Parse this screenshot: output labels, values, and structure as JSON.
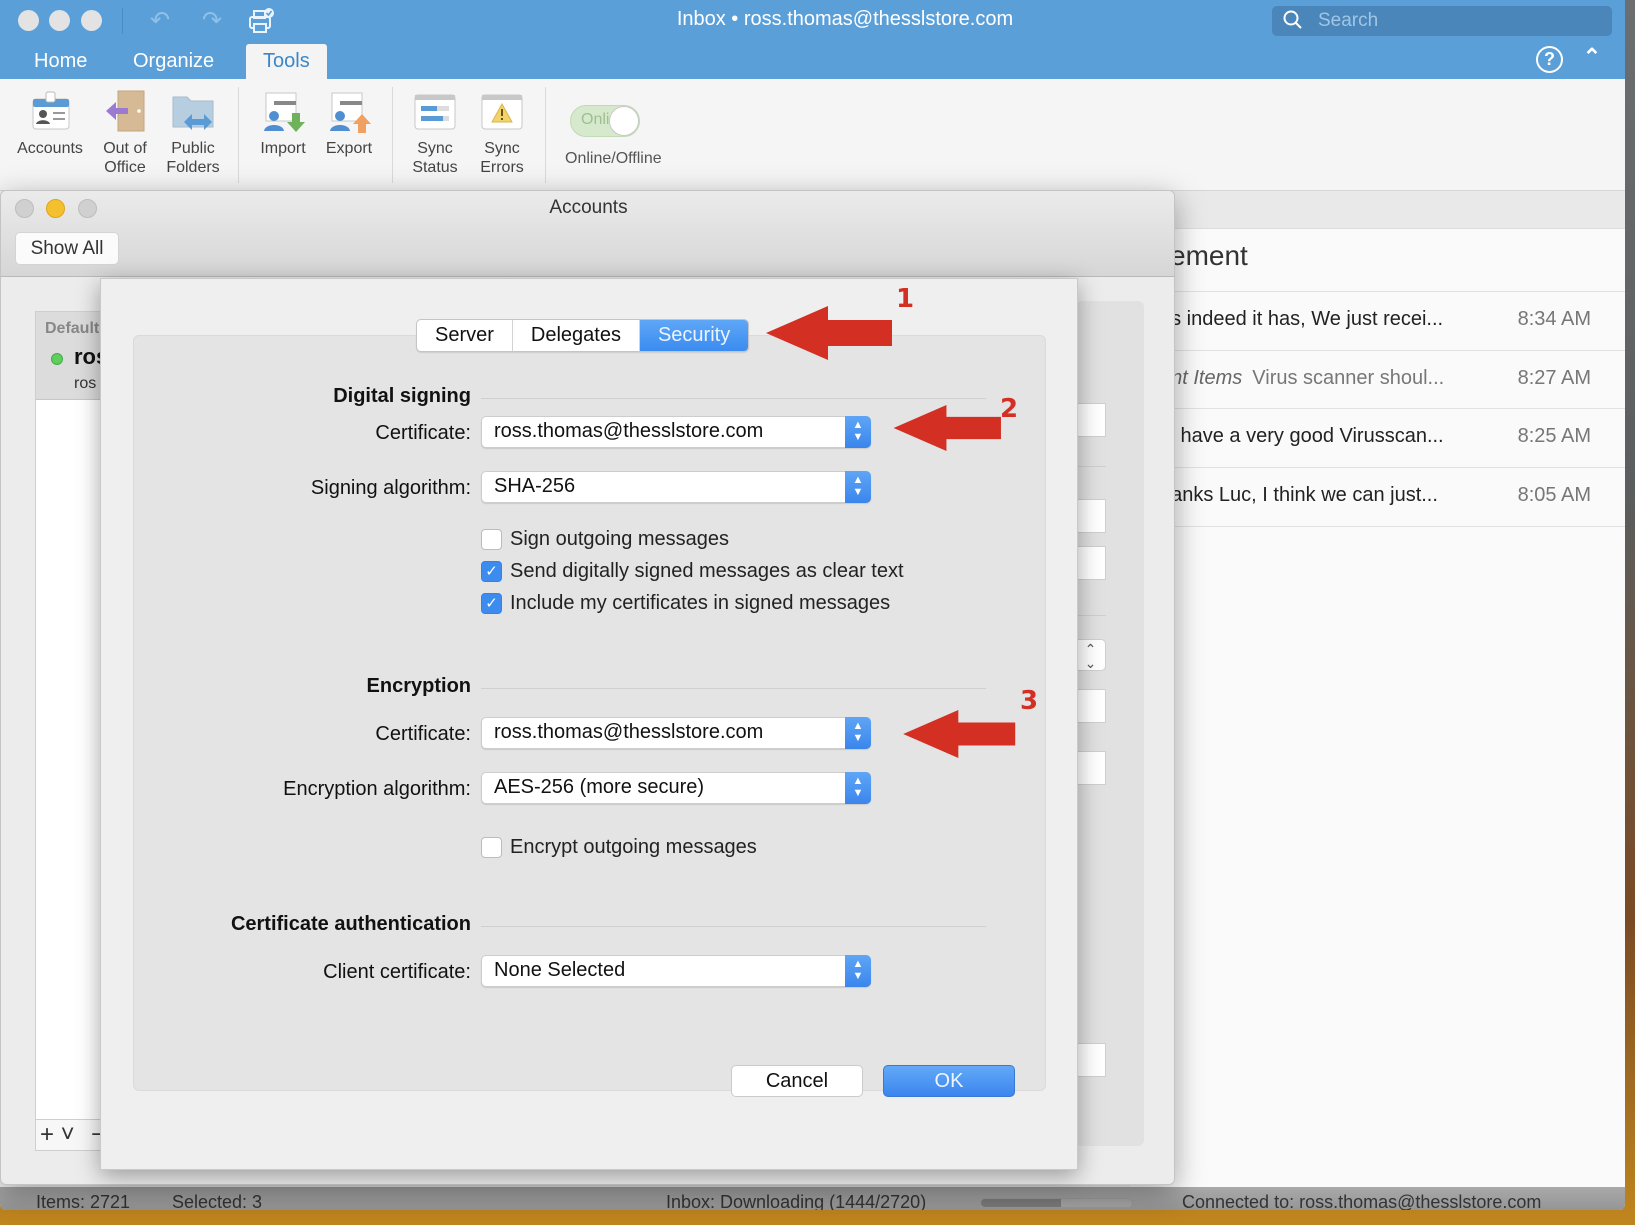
{
  "window": {
    "title": "Inbox • ross.thomas@thesslstore.com",
    "search_placeholder": "Search"
  },
  "quick_access": {
    "icons": [
      "undo-icon",
      "redo-icon",
      "print-icon"
    ]
  },
  "ribbon_tabs": [
    {
      "label": "Home",
      "active": false
    },
    {
      "label": "Organize",
      "active": false
    },
    {
      "label": "Tools",
      "active": true
    }
  ],
  "ribbon": {
    "buttons": [
      {
        "label": "Accounts",
        "icon": "accounts-card-icon"
      },
      {
        "label": "Out of Office",
        "line1": "Out of",
        "line2": "Office",
        "icon": "out-of-office-door-icon"
      },
      {
        "label": "Public Folders",
        "line1": "Public",
        "line2": "Folders",
        "icon": "public-folders-icon"
      },
      {
        "label": "Import",
        "icon": "import-icon"
      },
      {
        "label": "Export",
        "icon": "export-icon"
      },
      {
        "label": "Sync Status",
        "line1": "Sync",
        "line2": "Status",
        "icon": "sync-status-icon"
      },
      {
        "label": "Sync Errors",
        "line1": "Sync",
        "line2": "Errors",
        "icon": "sync-errors-icon"
      }
    ],
    "online_toggle": {
      "label": "Online",
      "caption": "Online/Offline",
      "on": true
    }
  },
  "message_list": {
    "title_fragment": "ement",
    "messages": [
      {
        "folder": "",
        "preview": "es indeed it has, We just recei...",
        "time": "8:34 AM",
        "muted": false
      },
      {
        "folder": "ent Items",
        "preview": "Virus scanner shoul...",
        "time": "8:27 AM",
        "muted": true
      },
      {
        "folder": "",
        "preview": "'e have a very good Virusscan...",
        "time": "8:25 AM",
        "muted": false
      },
      {
        "folder": "",
        "preview": "hanks Luc, I think we can just...",
        "time": "8:05 AM",
        "muted": false
      }
    ]
  },
  "status_bar": {
    "items": "Items: 2721",
    "selected": "Selected: 3",
    "download_status": "Inbox: Downloading (1444/2720)",
    "download_progress": 0.53,
    "connected": "Connected to: ross.thomas@thesslstore.com"
  },
  "accounts_window": {
    "title": "Accounts",
    "show_all": "Show All",
    "list": {
      "default_label": "Default",
      "account_name": "ros",
      "account_email": "ros"
    },
    "add_label": "+ ˅",
    "remove_label": "−"
  },
  "security_sheet": {
    "tabs": [
      {
        "label": "Server",
        "active": false
      },
      {
        "label": "Delegates",
        "active": false
      },
      {
        "label": "Security",
        "active": true
      }
    ],
    "digital_signing": {
      "heading": "Digital signing",
      "certificate_label": "Certificate:",
      "certificate_value": "ross.thomas@thesslstore.com",
      "algorithm_label": "Signing algorithm:",
      "algorithm_value": "SHA-256",
      "checkboxes": [
        {
          "label": "Sign outgoing messages",
          "checked": false
        },
        {
          "label": "Send digitally signed messages as clear text",
          "checked": true
        },
        {
          "label": "Include my certificates in signed messages",
          "checked": true
        }
      ]
    },
    "encryption": {
      "heading": "Encryption",
      "certificate_label": "Certificate:",
      "certificate_value": "ross.thomas@thesslstore.com",
      "algorithm_label": "Encryption algorithm:",
      "algorithm_value": "AES-256 (more secure)",
      "checkboxes": [
        {
          "label": "Encrypt outgoing messages",
          "checked": false
        }
      ]
    },
    "cert_auth": {
      "heading": "Certificate authentication",
      "client_label": "Client certificate:",
      "client_value": "None Selected"
    },
    "cancel": "Cancel",
    "ok": "OK"
  },
  "annotations": [
    {
      "number": "1",
      "color": "#d32f23"
    },
    {
      "number": "2",
      "color": "#d32f23"
    },
    {
      "number": "3",
      "color": "#d32f23"
    }
  ]
}
